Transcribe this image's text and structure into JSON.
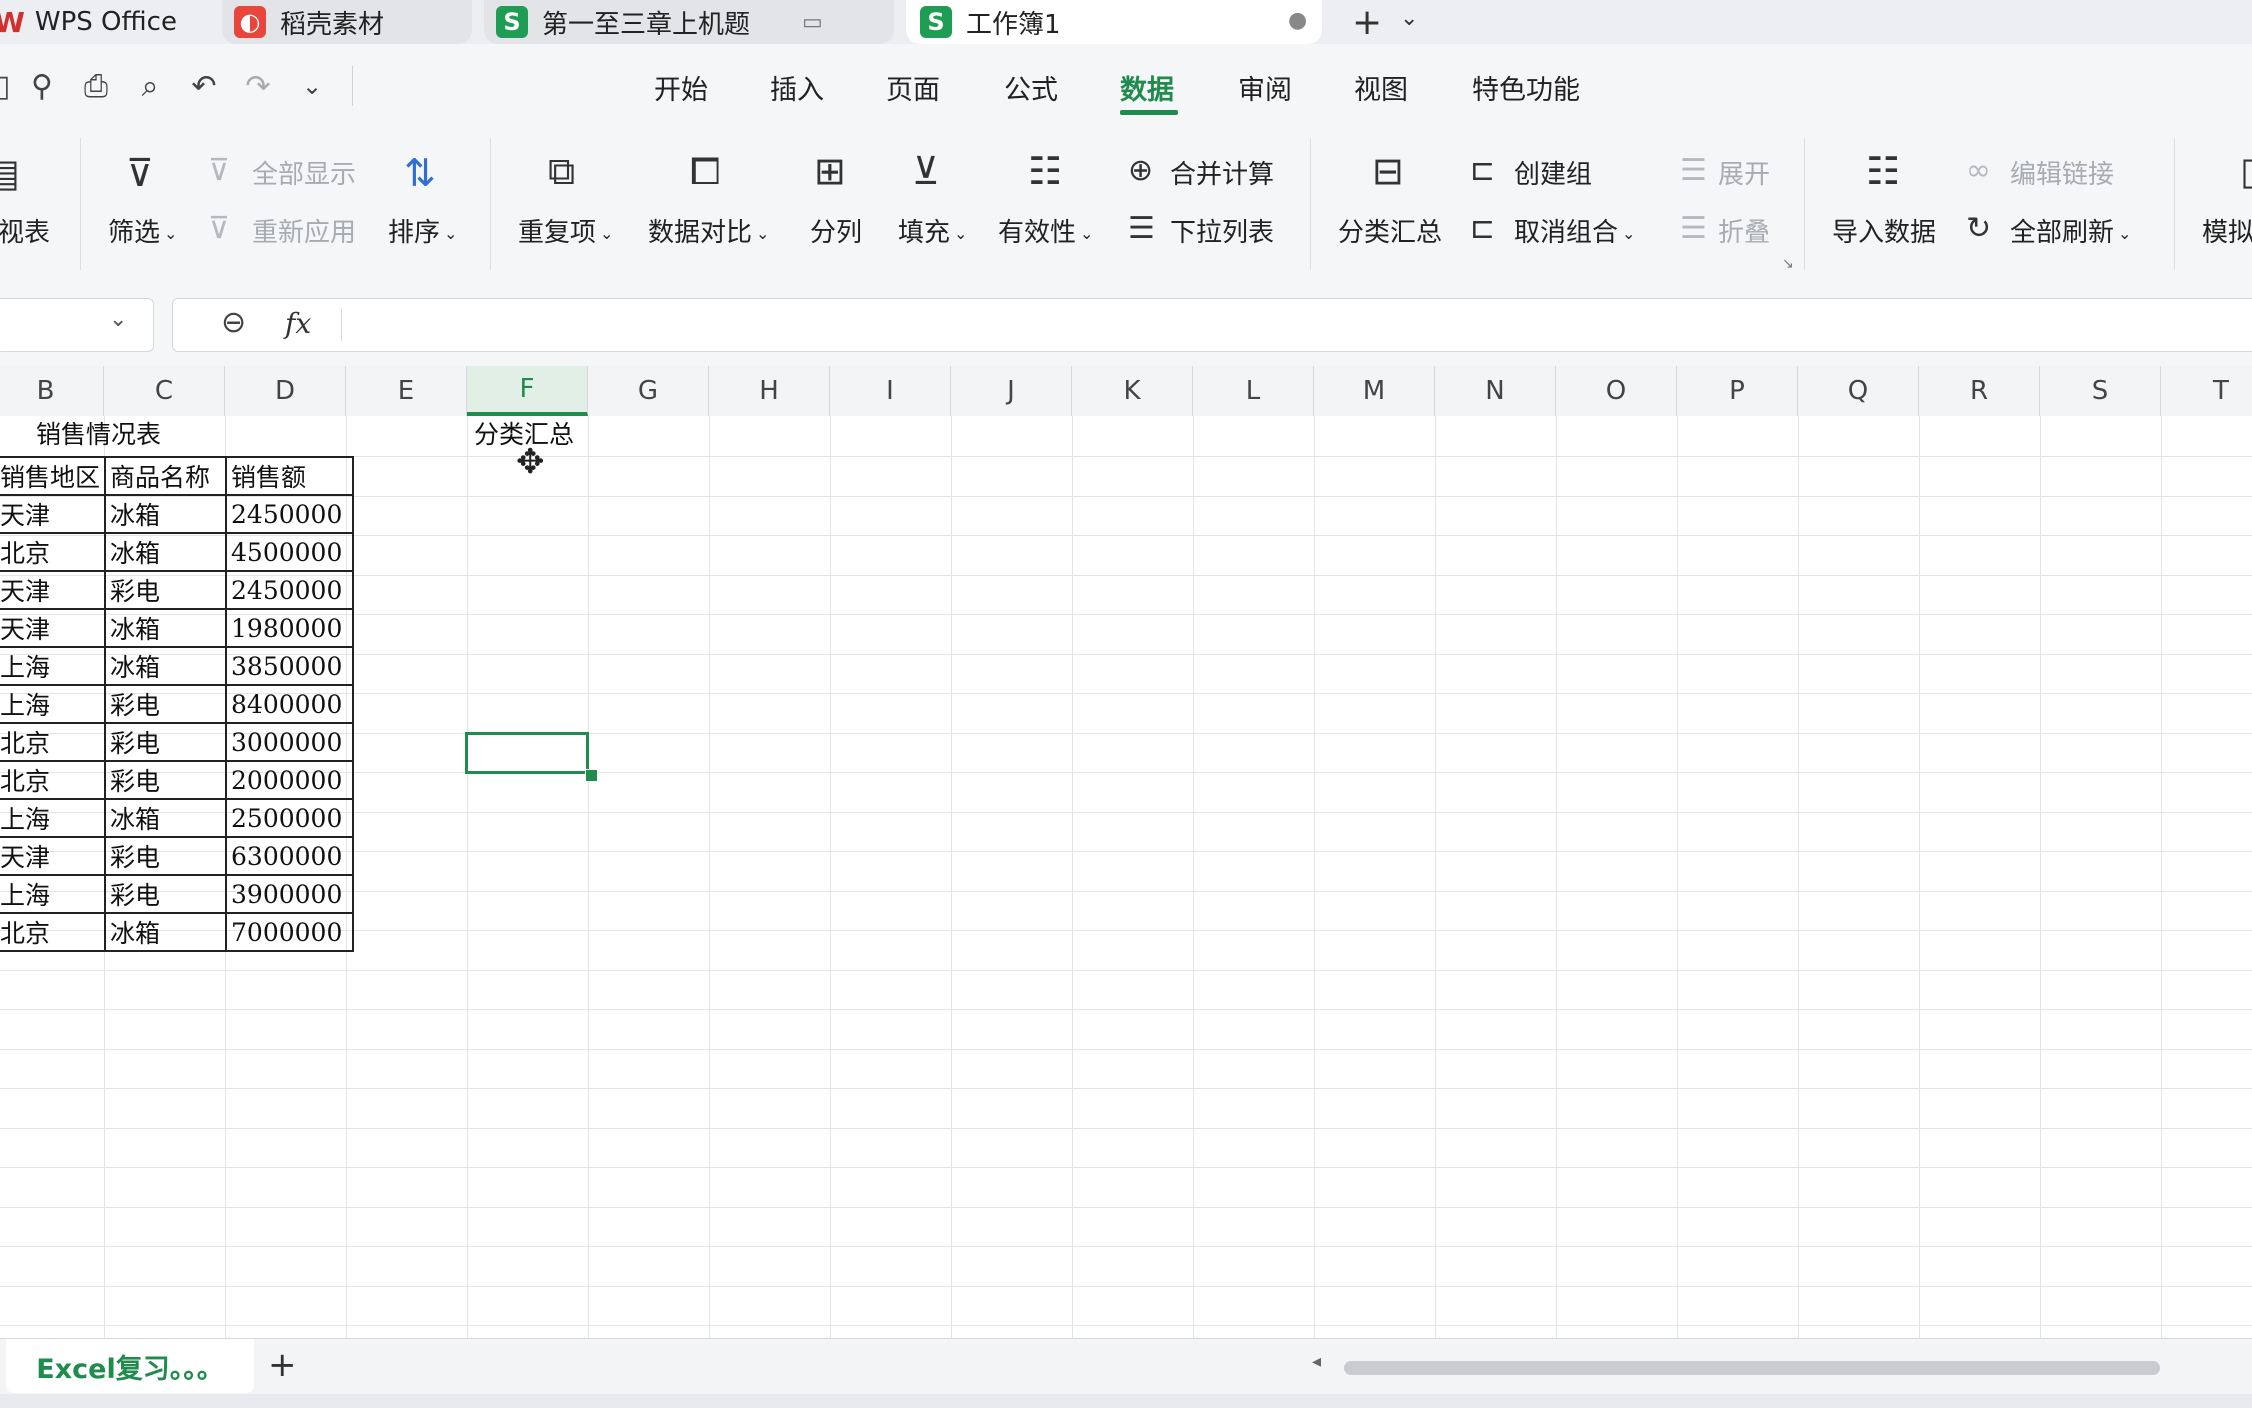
{
  "tabs": [
    {
      "label": "WPS Office",
      "icon": "wps-logo-icon"
    },
    {
      "label": "稻壳素材",
      "icon": "docer-icon"
    },
    {
      "label": "第一至三章上机题",
      "icon": "sheet-s-icon",
      "letter": "S"
    },
    {
      "label": "工作簿1",
      "icon": "sheet-s-icon",
      "letter": "S"
    }
  ],
  "menu": [
    "开始",
    "插入",
    "页面",
    "公式",
    "数据",
    "审阅",
    "视图",
    "特色功能"
  ],
  "menu_active": "数据",
  "ribbon": {
    "pivot": "视表",
    "filter": "筛选",
    "show_all": "全部显示",
    "reapply": "重新应用",
    "sort": "排序",
    "duplicates": "重复项",
    "compare": "数据对比",
    "split": "分列",
    "fill": "填充",
    "validity": "有效性",
    "consolidate": "合并计算",
    "dropdown": "下拉列表",
    "subtotal": "分类汇总",
    "group": "创建组",
    "ungroup": "取消组合",
    "expand": "展开",
    "collapse": "折叠",
    "import": "导入数据",
    "edit_links": "编辑链接",
    "refresh_all": "全部刷新",
    "simulate": "模拟"
  },
  "formula": {
    "fx": "fx",
    "value": ""
  },
  "columns": [
    "B",
    "C",
    "D",
    "E",
    "F",
    "G",
    "H",
    "I",
    "J",
    "K",
    "L",
    "M",
    "N",
    "O",
    "P",
    "Q",
    "R",
    "S",
    "T"
  ],
  "selected_column": "F",
  "sheet": {
    "title": "销售情况表",
    "f_header": "分类汇总",
    "headers": [
      "销售地区",
      "商品名称",
      "销售额"
    ],
    "rows": [
      [
        "天津",
        "冰箱",
        "2450000"
      ],
      [
        "北京",
        "冰箱",
        "4500000"
      ],
      [
        "天津",
        "彩电",
        "2450000"
      ],
      [
        "天津",
        "冰箱",
        "1980000"
      ],
      [
        "上海",
        "冰箱",
        "3850000"
      ],
      [
        "上海",
        "彩电",
        "8400000"
      ],
      [
        "北京",
        "彩电",
        "3000000"
      ],
      [
        "北京",
        "彩电",
        "2000000"
      ],
      [
        "上海",
        "冰箱",
        "2500000"
      ],
      [
        "天津",
        "彩电",
        "6300000"
      ],
      [
        "上海",
        "彩电",
        "3900000"
      ],
      [
        "北京",
        "冰箱",
        "7000000"
      ]
    ]
  },
  "sheet_tab": "Excel复习。。。",
  "add_sheet": "+",
  "accent": "#1f8b4c"
}
